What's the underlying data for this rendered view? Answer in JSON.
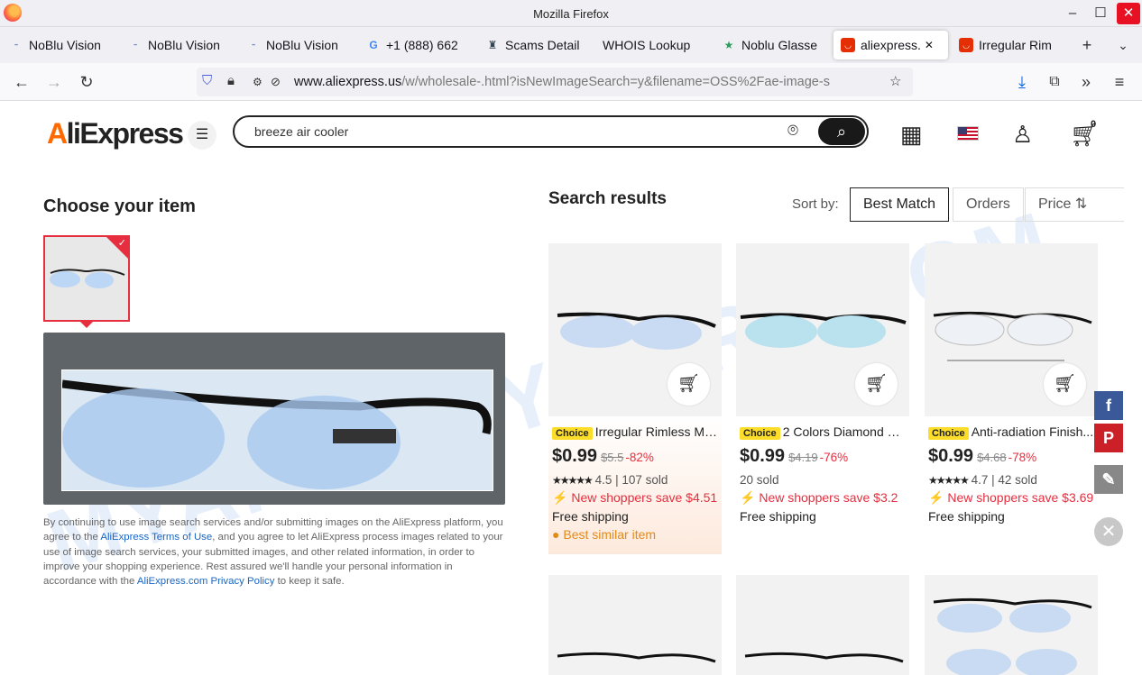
{
  "window": {
    "title": "Mozilla Firefox"
  },
  "tabs": [
    {
      "label": "NoBlu Vision",
      "icon": "noblu-favicon"
    },
    {
      "label": "NoBlu Vision",
      "icon": "noblu-favicon"
    },
    {
      "label": "NoBlu Vision",
      "icon": "noblu-favicon"
    },
    {
      "label": "+1 (888) 662",
      "icon": "google-favicon"
    },
    {
      "label": "Scams Detail",
      "icon": "scams-favicon"
    },
    {
      "label": "WHOIS Lookup",
      "icon": ""
    },
    {
      "label": "Noblu Glasse",
      "icon": "star-favicon"
    },
    {
      "label": "aliexpress.",
      "icon": "aliexpress-favicon"
    },
    {
      "label": "Irregular Rim",
      "icon": "aliexpress-favicon"
    }
  ],
  "nav": {
    "url_domain": "www.aliexpress.us",
    "url_path": "/w/wholesale-.html?isNewImageSearch=y&filename=OSS%2Fae-image-s"
  },
  "header": {
    "logo_a": "A",
    "logo_rest": "liExpress",
    "search_value": "breeze air cooler",
    "cart_count": "0",
    "colors": {
      "brand": "#ff6a00",
      "accent": "#e62e3f"
    }
  },
  "left": {
    "heading": "Choose your item",
    "legal_1": "By continuing to use image search services and/or submitting images on the AliExpress platform, you agree to the ",
    "legal_link1": "AliExpress Terms of Use",
    "legal_2": ", and you agree to let AliExpress process images related to your use of image search services, your submitted images, and other related information, in order to improve your shopping experience. Rest assured we'll handle your personal information in accordance with the ",
    "legal_link2": "AliExpress.com Privacy Policy",
    "legal_3": " to keep it safe."
  },
  "results": {
    "heading": "Search results",
    "sort_label": "Sort by:",
    "sort_options": [
      "Best Match",
      "Orders",
      "Price"
    ],
    "products": [
      {
        "badge": "Choice",
        "title": "Irregular Rimless My...",
        "price": "$0.99",
        "old_price": "$5.5",
        "discount": "-82%",
        "rating": "4.5",
        "sold": "107 sold",
        "promo": "New shoppers save $4.51",
        "shipping": "Free shipping",
        "tag": "Best similar item"
      },
      {
        "badge": "Choice",
        "title": "2 Colors Diamond Cu...",
        "price": "$0.99",
        "old_price": "$4.19",
        "discount": "-76%",
        "rating": "",
        "sold": "20 sold",
        "promo": "New shoppers save $3.2",
        "shipping": "Free shipping",
        "tag": ""
      },
      {
        "badge": "Choice",
        "title": "Anti-radiation Finish...",
        "price": "$0.99",
        "old_price": "$4.68",
        "discount": "-78%",
        "rating": "4.7",
        "sold": "42 sold",
        "promo": "New shoppers save $3.69",
        "shipping": "Free shipping",
        "tag": ""
      }
    ]
  },
  "watermark": "MYANTISPYWARE.COM"
}
